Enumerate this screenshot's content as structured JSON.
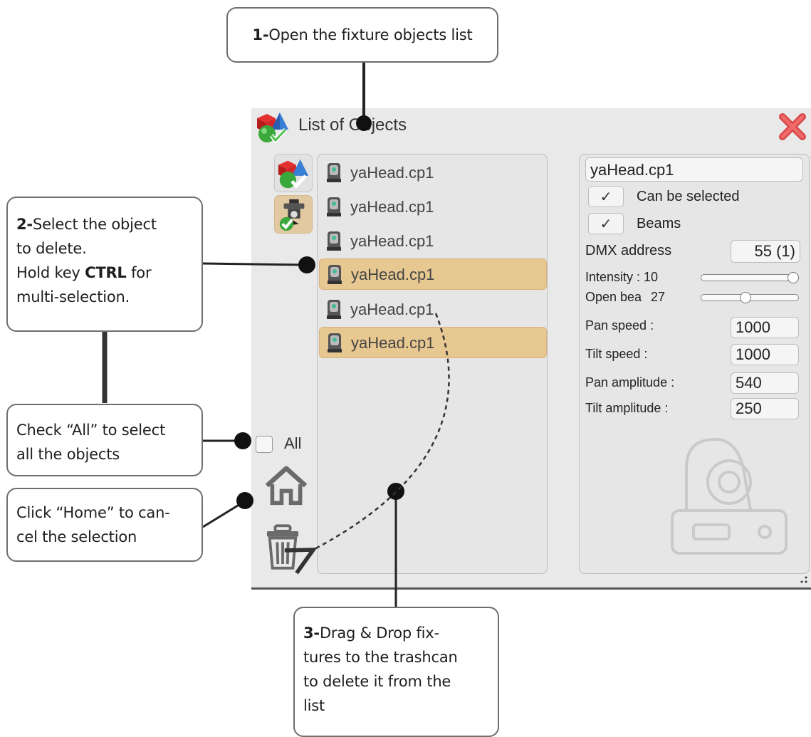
{
  "window": {
    "title": "List of Objects",
    "title_icon": "objects-icon",
    "close_icon": "close-x-icon",
    "left_tools": [
      {
        "icon": "objects-icon",
        "active": false
      },
      {
        "icon": "fixture-check-icon",
        "active": true
      }
    ],
    "all_checkbox_label": "All",
    "home_icon": "home-icon",
    "trash_icon": "trash-icon"
  },
  "object_list": [
    {
      "label": "yaHead.cp1",
      "selected": false
    },
    {
      "label": "yaHead.cp1",
      "selected": false
    },
    {
      "label": "yaHead.cp1",
      "selected": false
    },
    {
      "label": "yaHead.cp1",
      "selected": true
    },
    {
      "label": "yaHead.cp1",
      "selected": false
    },
    {
      "label": "yaHead.cp1",
      "selected": true
    }
  ],
  "properties": {
    "name_value": "yaHead.cp1",
    "can_be_selected_label": "Can be selected",
    "can_be_selected_check": "✓",
    "beams_label": "Beams",
    "beams_check": "✓",
    "dmx_label": "DMX address",
    "dmx_value": "55 (1)",
    "intensity_label": "Intensity : 10",
    "intensity_level": 1.0,
    "open_beam_label": "Open bea",
    "open_beam_value": "27",
    "open_beam_level": 0.45,
    "pan_speed_label": "Pan speed :",
    "pan_speed_value": "1000",
    "tilt_speed_label": "Tilt speed :",
    "tilt_speed_value": "1000",
    "pan_amplitude_label": "Pan amplitude :",
    "pan_amplitude_value": "540",
    "tilt_amplitude_label": "Tilt amplitude :",
    "tilt_amplitude_value": "250"
  },
  "callouts": {
    "c1_bold": "1-",
    "c1_text": "Open the fixture objects list",
    "c2_bold": "2-",
    "c2_text1": "Select the object",
    "c2_text2": "to delete.",
    "c2_text3": "Hold key ",
    "c2_key": "CTRL",
    "c2_text4": " for",
    "c2_text5": "multi-selection.",
    "c_all_line1": "Check “All” to select",
    "c_all_line2": "all the objects",
    "c_home_line1": "Click “Home” to can-",
    "c_home_line2": "cel the selection",
    "c3_bold": "3-",
    "c3_line1": "Drag & Drop fix-",
    "c3_line2": "tures to the trashcan",
    "c3_line3": "to delete it from the",
    "c3_line4": "list"
  }
}
